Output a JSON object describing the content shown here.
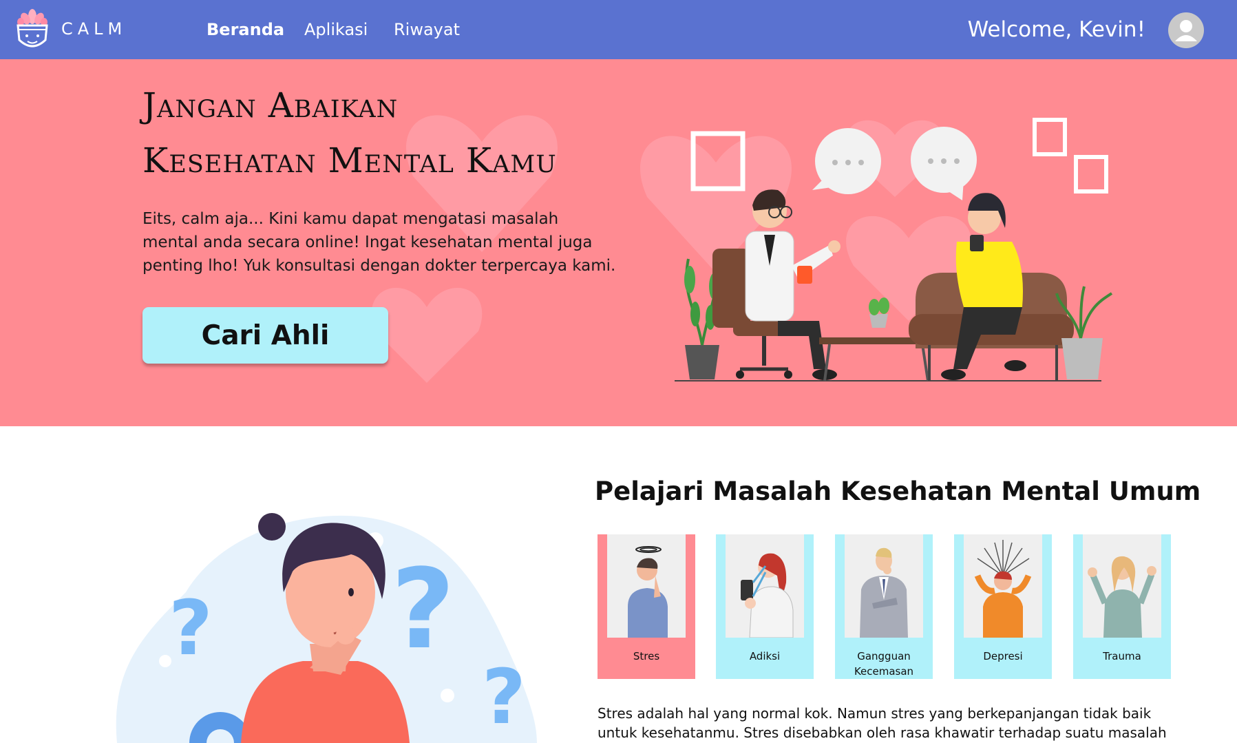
{
  "nav": {
    "brand": "CALM",
    "links": [
      {
        "label": "Beranda",
        "active": true
      },
      {
        "label": "Aplikasi",
        "active": false
      },
      {
        "label": "Riwayat",
        "active": false
      }
    ],
    "welcome": "Welcome, Kevin!",
    "avatar_icon": "user-icon"
  },
  "hero": {
    "title_line1": "Jangan Abaikan",
    "title_line2": "Kesehatan Mental Kamu",
    "description": "Eits, calm aja... Kini kamu dapat mengatasi masalah mental anda secara online! Ingat kesehatan mental juga penting lho! Yuk konsultasi dengan dokter terpercaya kami.",
    "cta_label": "Cari Ahli",
    "illustration": "doctor-consultation-illustration"
  },
  "learn": {
    "title": "Pelajari Masalah Kesehatan Mental Umum",
    "illustration": "thinking-woman-illustration",
    "cards": [
      {
        "label": "Stres",
        "selected": true,
        "icon": "stress-person-icon"
      },
      {
        "label": "Adiksi",
        "selected": false,
        "icon": "phone-addiction-icon"
      },
      {
        "label": "Gangguan Kecemasan",
        "selected": false,
        "icon": "anxious-man-icon"
      },
      {
        "label": "Depresi",
        "selected": false,
        "icon": "depressed-person-icon"
      },
      {
        "label": "Trauma",
        "selected": false,
        "icon": "trauma-person-icon"
      }
    ],
    "description": "Stres adalah hal yang normal kok. Namun stres yang berkepanjangan tidak baik untuk kesehatanmu. Stres disebabkan oleh rasa khawatir terhadap suatu masalah yang"
  },
  "colors": {
    "navbar": "#5a72d0",
    "hero_bg": "#ff8b92",
    "card_bg": "#b0f1fa",
    "card_selected": "#ff8b92",
    "cta_bg": "#b0f1fa"
  }
}
